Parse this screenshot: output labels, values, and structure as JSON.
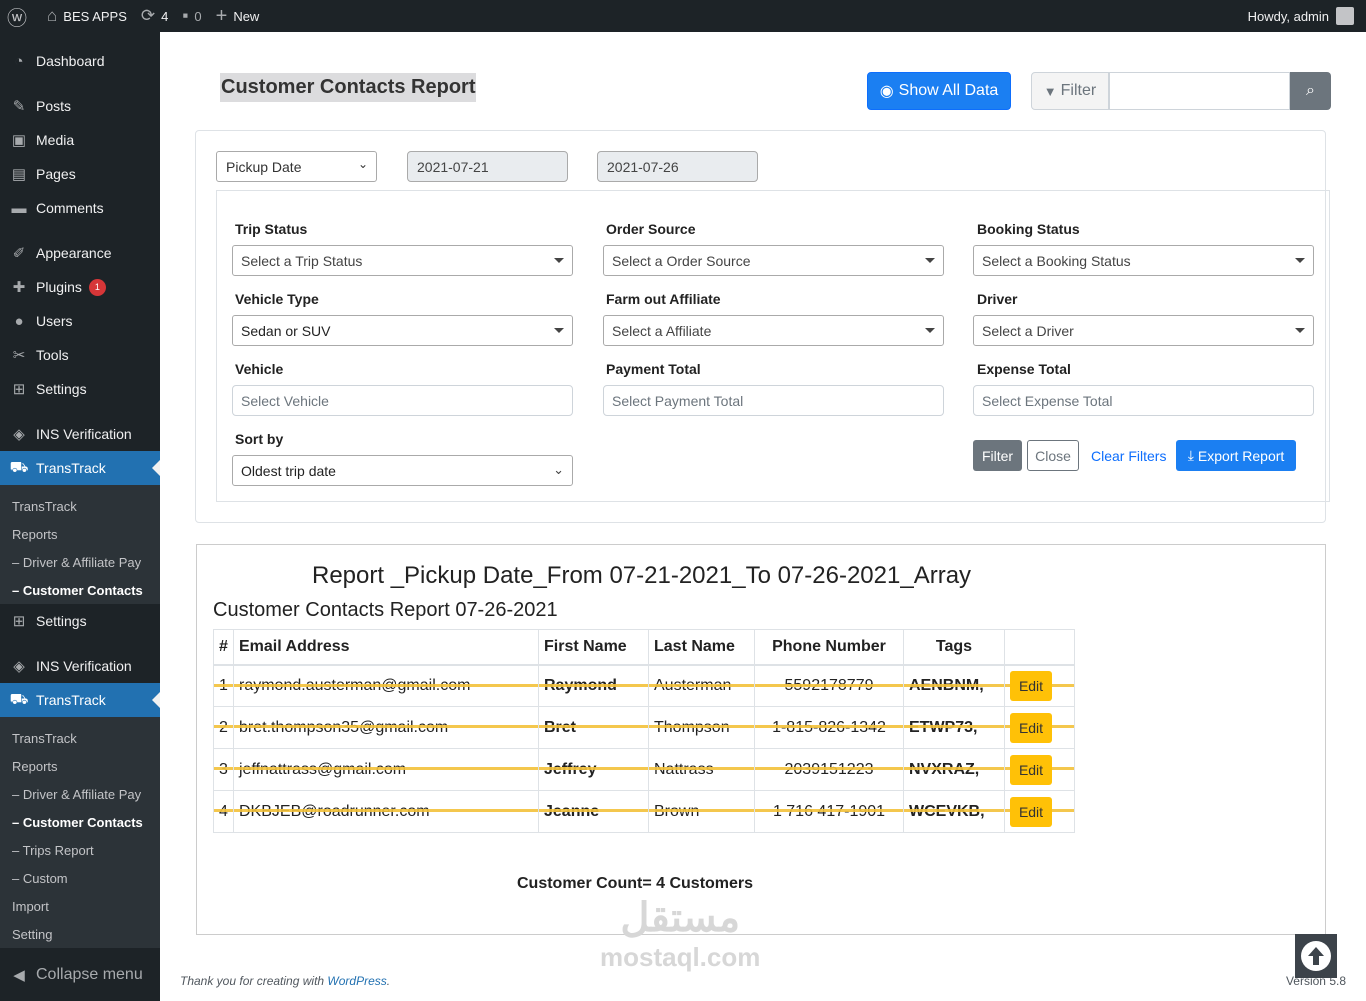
{
  "adminbar": {
    "site_name": "BES APPS",
    "updates_count": "4",
    "comments_count": "0",
    "new_label": "New",
    "howdy": "Howdy, admin"
  },
  "sidebar": {
    "top_items": [
      {
        "label": "Dashboard",
        "icon": "dashboard-icon"
      },
      {
        "label": "Posts",
        "icon": "pin-icon"
      },
      {
        "label": "Media",
        "icon": "media-icon"
      },
      {
        "label": "Pages",
        "icon": "pages-icon"
      },
      {
        "label": "Comments",
        "icon": "comments-icon"
      },
      {
        "label": "Appearance",
        "icon": "brush-icon"
      },
      {
        "label": "Plugins",
        "icon": "plugin-icon",
        "badge": "1"
      },
      {
        "label": "Users",
        "icon": "users-icon"
      },
      {
        "label": "Tools",
        "icon": "wrench-icon"
      },
      {
        "label": "Settings",
        "icon": "settings-icon"
      },
      {
        "label": "INS Verification",
        "icon": "shield-icon"
      },
      {
        "label": "TransTrack",
        "icon": "car-icon"
      }
    ],
    "submenu1": [
      "TransTrack",
      "Reports",
      "– Driver & Affiliate Pay",
      "– Customer Contacts"
    ],
    "settings2": "Settings",
    "ins2": "INS Verification",
    "transtrack2": "TransTrack",
    "submenu2": [
      "TransTrack",
      "Reports",
      "– Driver & Affiliate Pay",
      "– Customer Contacts",
      "– Trips Report",
      "– Custom",
      "Import",
      "Setting"
    ],
    "collapse": "Collapse menu"
  },
  "header": {
    "title": "Customer Contacts Report",
    "show_all": "Show All Data",
    "filter": "Filter"
  },
  "filters": {
    "date_type": "Pickup Date",
    "date_from": "2021-07-21",
    "date_to": "2021-07-26",
    "trip_status_label": "Trip Status",
    "trip_status_value": "Select a Trip Status",
    "order_source_label": "Order Source",
    "order_source_value": "Select a Order Source",
    "booking_status_label": "Booking Status",
    "booking_status_value": "Select a Booking Status",
    "vehicle_type_label": "Vehicle Type",
    "vehicle_type_value": "Sedan or SUV",
    "affiliate_label": "Farm out Affiliate",
    "affiliate_value": "Select a Affiliate",
    "driver_label": "Driver",
    "driver_value": "Select a Driver",
    "vehicle_label": "Vehicle",
    "vehicle_placeholder": "Select Vehicle",
    "payment_label": "Payment Total",
    "payment_placeholder": "Select Payment Total",
    "expense_label": "Expense Total",
    "expense_placeholder": "Select Expense Total",
    "sort_label": "Sort by",
    "sort_value": "Oldest trip date",
    "btn_filter": "Filter",
    "btn_close": "Close",
    "clear": "Clear Filters",
    "export": "Export Report"
  },
  "report": {
    "heading": "Report _Pickup Date_From 07-21-2021_To 07-26-2021_Array",
    "subheading": "Customer Contacts Report 07-26-2021",
    "columns": [
      "#",
      "Email Address",
      "First Name",
      "Last Name",
      "Phone Number",
      "Tags",
      ""
    ],
    "rows": [
      {
        "n": "1",
        "email": "raymond.austerman@gmail.com",
        "first": "Raymond",
        "last": "Austerman",
        "phone": "5592178779",
        "tags": "AENBNM,",
        "action": "Edit"
      },
      {
        "n": "2",
        "email": "bret.thompson35@gmail.com",
        "first": "Bret",
        "last": "Thompson",
        "phone": "1-815-826-1342",
        "tags": "ETWP73,",
        "action": "Edit"
      },
      {
        "n": "3",
        "email": "jeffnattrass@gmail.com",
        "first": "Jeffrey",
        "last": "Nattrass",
        "phone": "2039151223",
        "tags": "NVXRAZ,",
        "action": "Edit"
      },
      {
        "n": "4",
        "email": "DKBJEB@roadrunner.com",
        "first": "Jeanne",
        "last": "Brown",
        "phone": "1 716 417-1901",
        "tags": "WCEVKB,",
        "action": "Edit"
      }
    ],
    "count": "Customer Count= 4 Customers"
  },
  "footer": {
    "thanks_prefix": "Thank you for creating with ",
    "wordpress": "WordPress",
    "thanks_suffix": ".",
    "version": "Version 5.8"
  },
  "watermark": {
    "arabic": "مستقل",
    "latin": "mostaql.com"
  },
  "colors": {
    "primary": "#1b7ff2",
    "wp_blue": "#2271b1",
    "sidebar": "#1d2327",
    "highlight": "#f3c13a",
    "edit": "#ffc107"
  }
}
